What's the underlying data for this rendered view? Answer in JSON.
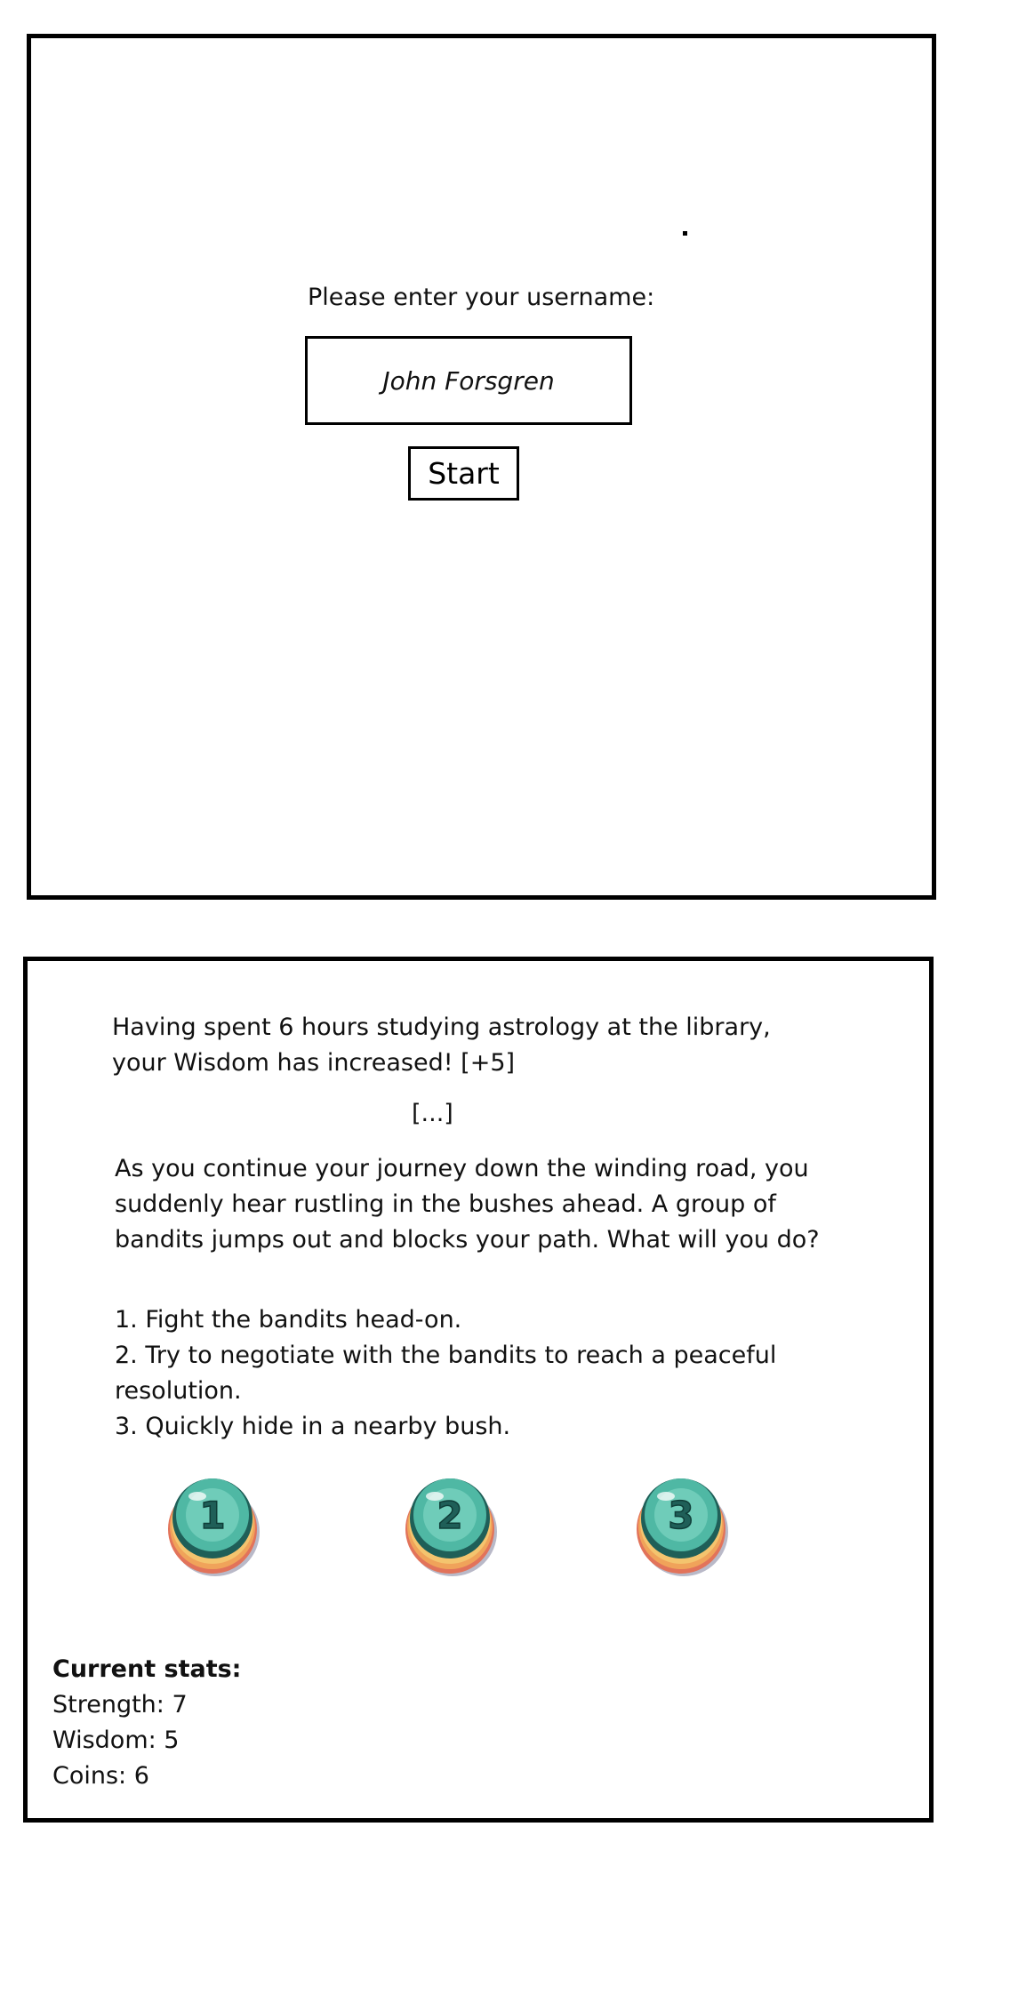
{
  "login": {
    "prompt": "Please enter your username:",
    "username_value": "John Forsgren",
    "start_label": "Start"
  },
  "game": {
    "narration_1": "Having spent 6 hours studying astrology at the library, your Wisdom has increased! [+5]",
    "ellipsis": "[...]",
    "narration_2": "As you continue your journey down the winding road, you suddenly hear rustling in the bushes ahead. A group of bandits jumps out and blocks your path. What will you do?",
    "options": [
      "1. Fight the bandits head-on.",
      "2. Try to negotiate with the bandits to reach a peaceful resolution.",
      "3. Quickly hide in a nearby bush."
    ],
    "choice_buttons": [
      {
        "label": "1",
        "icon": "numbered-gem-button-icon"
      },
      {
        "label": "2",
        "icon": "numbered-gem-button-icon"
      },
      {
        "label": "3",
        "icon": "numbered-gem-button-icon"
      }
    ],
    "stats": {
      "title": "Current stats:",
      "strength": "Strength: 7",
      "wisdom": "Wisdom: 5",
      "coins": "Coins: 6"
    }
  },
  "colors": {
    "border": "#000000",
    "gem_teal": "#4fb8a4",
    "gem_dark": "#1f5f58",
    "ring_orange": "#f0a35a",
    "ring_red": "#e2735a"
  }
}
